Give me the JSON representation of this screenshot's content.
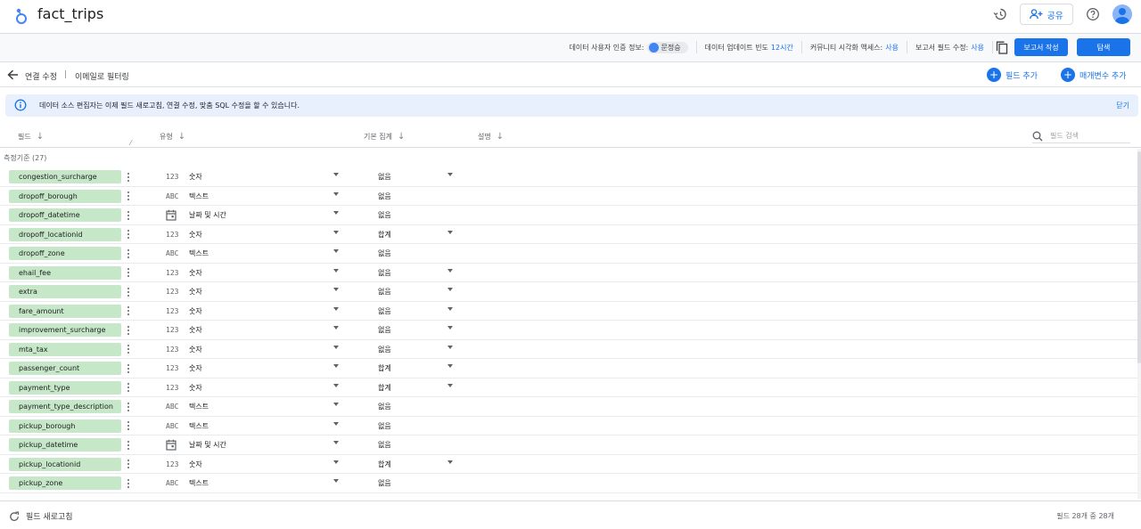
{
  "app": {
    "title": "fact_trips"
  },
  "header": {
    "share_label": "공유"
  },
  "infobar": {
    "credentials_label": "데이터 사용자 인증 정보:",
    "credentials_user": "문정승",
    "freshness_label": "데이터 업데이트 빈도",
    "freshness_value": "12시간",
    "community_label": "커뮤니티 시각화 액세스:",
    "community_value": "사용",
    "report_edit_label": "보고서 필드 수정:",
    "report_edit_value": "사용",
    "create_report_label": "보고서 작성",
    "explore_label": "탐색"
  },
  "breadcrumb": {
    "edit_connection": "연결 수정",
    "separator": "|",
    "filter_by_email": "이메일로 필터링"
  },
  "actions": {
    "add_field": "필드 추가",
    "add_parameter": "매개변수 추가"
  },
  "banner": {
    "text": "데이터 소스 편집자는 이제 필드 새로고침, 연결 수정, 맞춤 SQL 수정을 할 수 있습니다.",
    "close": "닫기"
  },
  "columns": {
    "field": "필드",
    "type": "유형",
    "aggregation": "기본 집계",
    "description": "설명",
    "search_placeholder": "필드 검색"
  },
  "section": {
    "label": "측정기준 (27)"
  },
  "fields": [
    {
      "name": "congestion_surcharge",
      "type_icon": "123",
      "type": "숫자",
      "agg": "없음",
      "agg_dropdown": true
    },
    {
      "name": "dropoff_borough",
      "type_icon": "ABC",
      "type": "텍스트",
      "agg": "없음",
      "agg_dropdown": false
    },
    {
      "name": "dropoff_datetime",
      "type_icon": "calendar",
      "type": "날짜 및 시간",
      "agg": "없음",
      "agg_dropdown": false
    },
    {
      "name": "dropoff_locationid",
      "type_icon": "123",
      "type": "숫자",
      "agg": "합계",
      "agg_dropdown": true
    },
    {
      "name": "dropoff_zone",
      "type_icon": "ABC",
      "type": "텍스트",
      "agg": "없음",
      "agg_dropdown": false
    },
    {
      "name": "ehail_fee",
      "type_icon": "123",
      "type": "숫자",
      "agg": "없음",
      "agg_dropdown": true
    },
    {
      "name": "extra",
      "type_icon": "123",
      "type": "숫자",
      "agg": "없음",
      "agg_dropdown": true
    },
    {
      "name": "fare_amount",
      "type_icon": "123",
      "type": "숫자",
      "agg": "없음",
      "agg_dropdown": true
    },
    {
      "name": "improvement_surcharge",
      "type_icon": "123",
      "type": "숫자",
      "agg": "없음",
      "agg_dropdown": true
    },
    {
      "name": "mta_tax",
      "type_icon": "123",
      "type": "숫자",
      "agg": "없음",
      "agg_dropdown": true
    },
    {
      "name": "passenger_count",
      "type_icon": "123",
      "type": "숫자",
      "agg": "합계",
      "agg_dropdown": true
    },
    {
      "name": "payment_type",
      "type_icon": "123",
      "type": "숫자",
      "agg": "합계",
      "agg_dropdown": true
    },
    {
      "name": "payment_type_description",
      "type_icon": "ABC",
      "type": "텍스트",
      "agg": "없음",
      "agg_dropdown": false
    },
    {
      "name": "pickup_borough",
      "type_icon": "ABC",
      "type": "텍스트",
      "agg": "없음",
      "agg_dropdown": false
    },
    {
      "name": "pickup_datetime",
      "type_icon": "calendar",
      "type": "날짜 및 시간",
      "agg": "없음",
      "agg_dropdown": false
    },
    {
      "name": "pickup_locationid",
      "type_icon": "123",
      "type": "숫자",
      "agg": "합계",
      "agg_dropdown": true
    },
    {
      "name": "pickup_zone",
      "type_icon": "ABC",
      "type": "텍스트",
      "agg": "없음",
      "agg_dropdown": false
    }
  ],
  "footer": {
    "refresh_label": "필드 새로고침",
    "count_text": "필드 28개 중 28개"
  },
  "colors": {
    "accent": "#1a73e8",
    "field_chip": "#c6e7c8",
    "banner_bg": "#e8f0fe"
  }
}
